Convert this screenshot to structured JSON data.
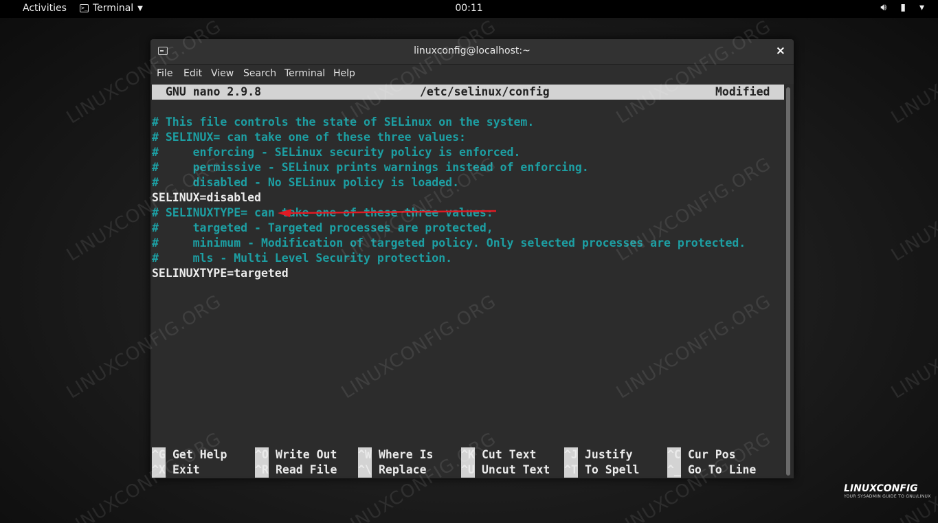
{
  "topbar": {
    "activities": "Activities",
    "app_menu": "Terminal",
    "clock": "00:11",
    "tray_icons": [
      "volume-icon",
      "battery-icon",
      "power-menu-icon"
    ]
  },
  "window": {
    "title": "linuxconfig@localhost:~",
    "close_glyph": "×",
    "menu": [
      "File",
      "Edit",
      "View",
      "Search",
      "Terminal",
      "Help"
    ]
  },
  "nano": {
    "version": "GNU nano 2.9.8",
    "file": "/etc/selinux/config",
    "status": "Modified",
    "lines": [
      {
        "text": "",
        "kind": "blank"
      },
      {
        "text": "# This file controls the state of SELinux on the system.",
        "kind": "comment"
      },
      {
        "text": "# SELINUX= can take one of these three values:",
        "kind": "comment"
      },
      {
        "text": "#     enforcing - SELinux security policy is enforced.",
        "kind": "comment"
      },
      {
        "text": "#     permissive - SELinux prints warnings instead of enforcing.",
        "kind": "comment"
      },
      {
        "text": "#     disabled - No SELinux policy is loaded.",
        "kind": "comment"
      },
      {
        "text": "SELINUX=disabled",
        "kind": "config"
      },
      {
        "text": "# SELINUXTYPE= can take one of these three values:",
        "kind": "comment"
      },
      {
        "text": "#     targeted - Targeted processes are protected,",
        "kind": "comment"
      },
      {
        "text": "#     minimum - Modification of targeted policy. Only selected processes are protected.",
        "kind": "comment"
      },
      {
        "text": "#     mls - Multi Level Security protection.",
        "kind": "comment"
      },
      {
        "text": "SELINUXTYPE=targeted",
        "kind": "config"
      }
    ],
    "shortcuts_row1": [
      {
        "key": "^G",
        "label": "Get Help"
      },
      {
        "key": "^O",
        "label": "Write Out"
      },
      {
        "key": "^W",
        "label": "Where Is"
      },
      {
        "key": "^K",
        "label": "Cut Text"
      },
      {
        "key": "^J",
        "label": "Justify"
      },
      {
        "key": "^C",
        "label": "Cur Pos"
      }
    ],
    "shortcuts_row2": [
      {
        "key": "^X",
        "label": "Exit"
      },
      {
        "key": "^R",
        "label": "Read File"
      },
      {
        "key": "^\\",
        "label": "Replace"
      },
      {
        "key": "^U",
        "label": "Uncut Text"
      },
      {
        "key": "^T",
        "label": "To Spell"
      },
      {
        "key": "^_",
        "label": "Go To Line"
      }
    ]
  },
  "annotation": {
    "color": "#e01b24"
  },
  "watermark": "LINUXCONFIG.ORG",
  "logo": {
    "name": "LINUXCONFIG",
    "tagline": "YOUR SYSADMIN GUIDE TO GNU/LINUX"
  },
  "colors": {
    "comment": "#1d9fa3",
    "config": "#ececec",
    "header_bg": "#d3d3d3"
  }
}
